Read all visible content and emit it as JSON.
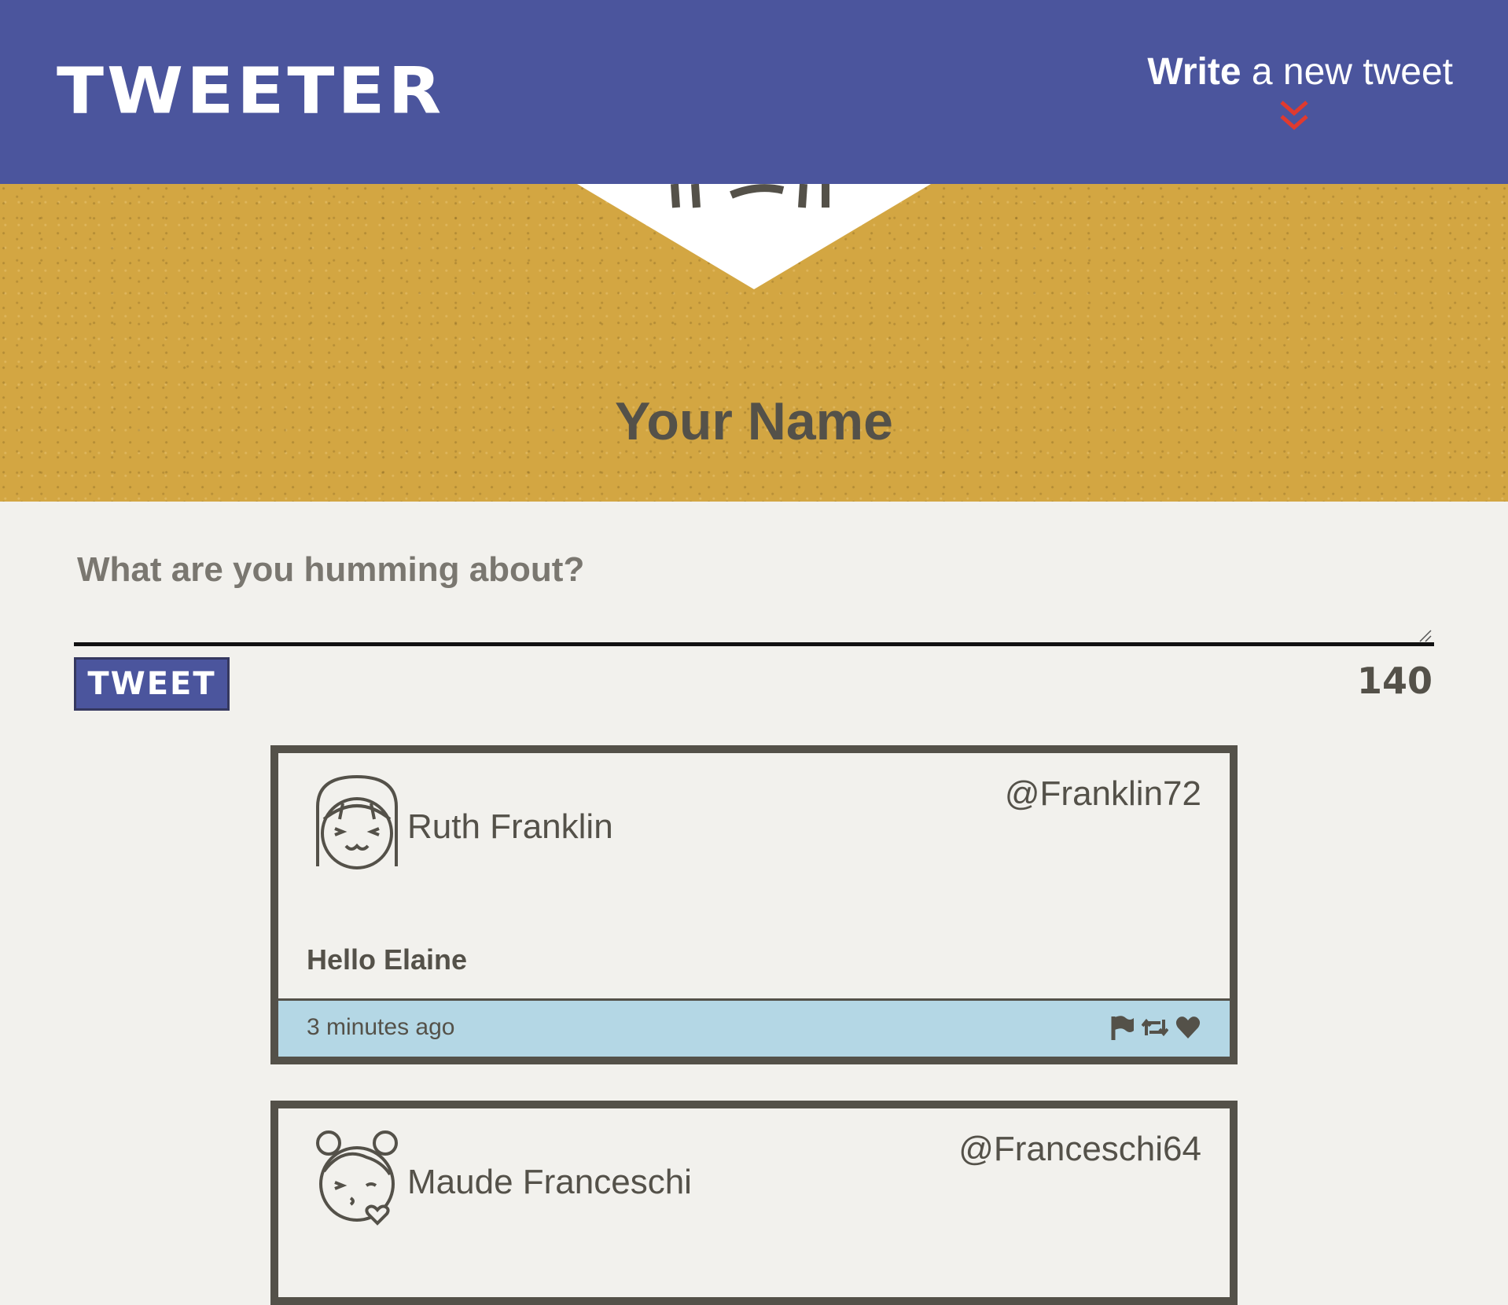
{
  "nav": {
    "brand": "TWEETER",
    "compose_bold": "Write",
    "compose_rest": " a new tweet",
    "colors": {
      "bar": "#4b559d",
      "chevron": "#e03a2f"
    }
  },
  "profile": {
    "name": "Your Name"
  },
  "composer": {
    "placeholder": "What are you humming about?",
    "button_label": "TWEET",
    "char_count": "140"
  },
  "tweets": [
    {
      "name": "Ruth Franklin",
      "handle": "@Franklin72",
      "text": "Hello Elaine",
      "time": "3 minutes ago",
      "avatar": "smiling-girl-icon"
    },
    {
      "name": "Maude Franceschi",
      "handle": "@Franceschi64",
      "avatar": "kissing-girl-icon"
    }
  ],
  "icons": [
    "flag-icon",
    "retweet-icon",
    "heart-icon"
  ]
}
